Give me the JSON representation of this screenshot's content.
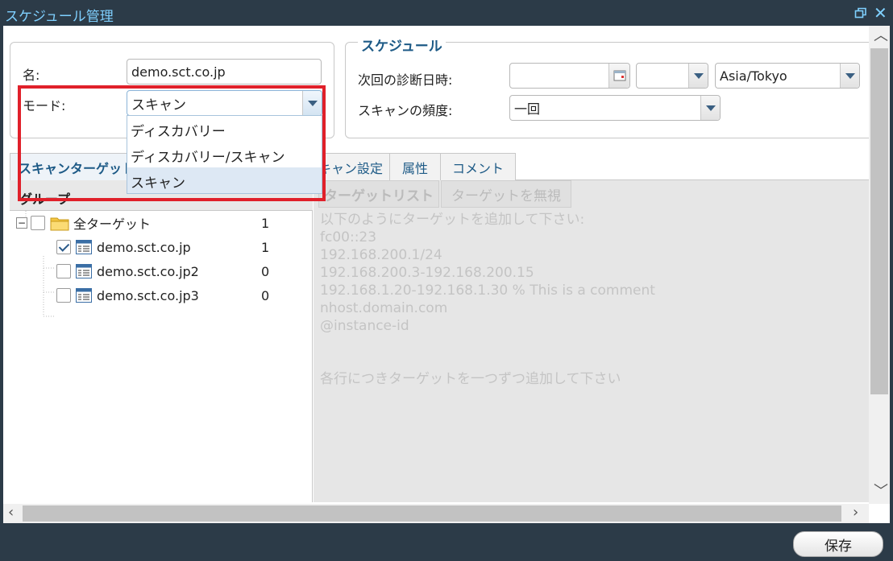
{
  "window": {
    "title": "スケジュール管理",
    "restore_icon": "restore-window-icon",
    "close_icon": "close-icon"
  },
  "general": {
    "name_label": "名:",
    "name_value": "demo.sct.co.jp",
    "mode_label": "モード:",
    "mode_value": "スキャン",
    "mode_options": [
      "ディスカバリー",
      "ディスカバリー/スキャン",
      "スキャン"
    ],
    "mode_selected_index": 2
  },
  "schedule": {
    "legend": "スケジュール",
    "next_date_label": "次回の診断日時:",
    "date_value": "",
    "time_value": "",
    "timezone_value": "Asia/Tokyo",
    "frequency_label": "スキャンの頻度:",
    "frequency_value": "一回"
  },
  "tabs": [
    {
      "label": "スキャンターゲット",
      "active": true
    },
    {
      "label": "スキャン設定",
      "active": false
    },
    {
      "label": "属性",
      "active": false
    },
    {
      "label": "コメント",
      "active": false
    }
  ],
  "group_panel": {
    "header": "グループ",
    "tree": [
      {
        "label": "全ターゲット",
        "count": "1",
        "checked": false,
        "level": 0
      },
      {
        "label": "demo.sct.co.jp",
        "count": "1",
        "checked": true,
        "level": 1
      },
      {
        "label": "demo.sct.co.jp2",
        "count": "0",
        "checked": false,
        "level": 1
      },
      {
        "label": "demo.sct.co.jp3",
        "count": "0",
        "checked": false,
        "level": 1
      }
    ]
  },
  "target_panel": {
    "tab_list": "ターゲットリスト",
    "tab_ignore": "ターゲットを無視",
    "placeholder_lines": [
      "以下のようにターゲットを追加して下さい:",
      "fc00::23",
      "192.168.200.1/24",
      "192.168.200.3-192.168.200.15",
      "192.168.1.20-192.168.1.30 % This is a comment",
      "nhost.domain.com",
      "@instance-id",
      "",
      "",
      "各行につきターゲットを一つずつ追加して下さい"
    ]
  },
  "footer": {
    "save_label": "保存"
  }
}
